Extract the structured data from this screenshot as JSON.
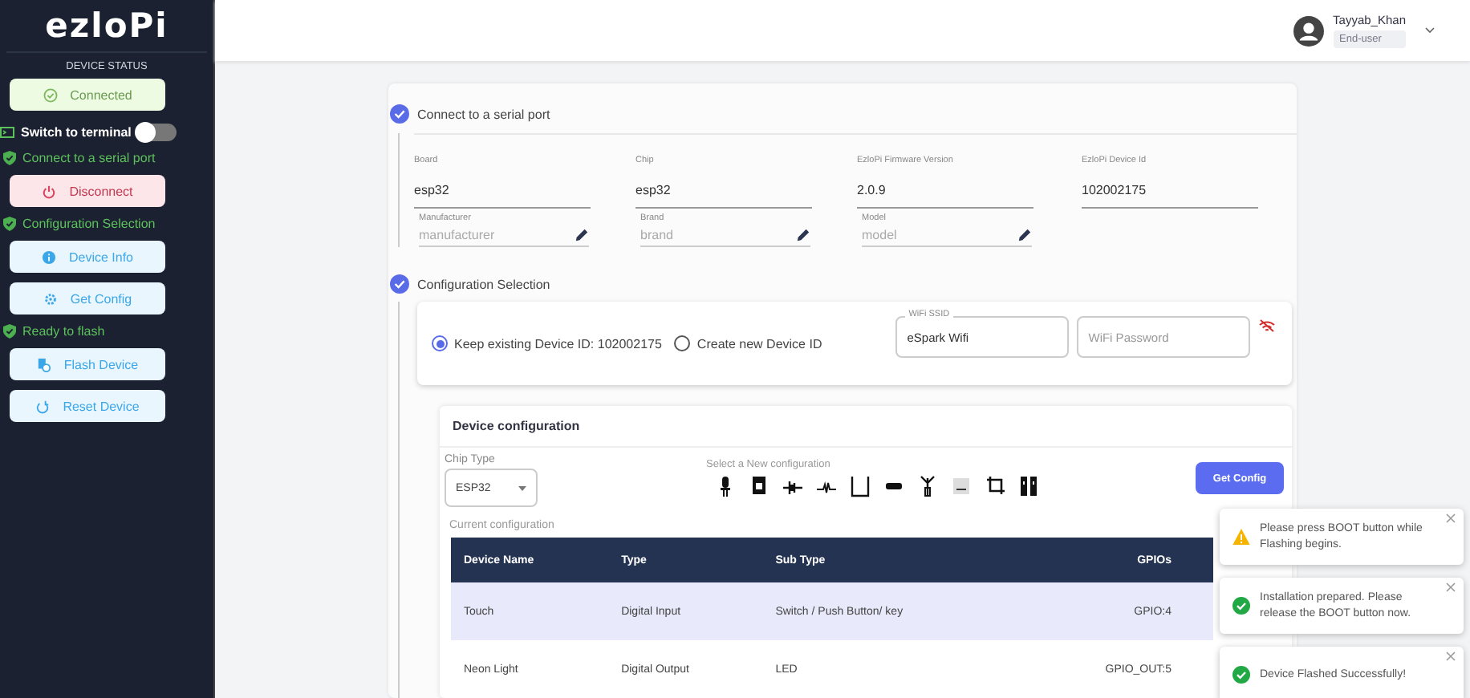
{
  "sidebar": {
    "logo": "ezloPi",
    "status_heading": "DEVICE STATUS",
    "status_button": {
      "label": "Connected",
      "kind": "status"
    },
    "terminal_switch": {
      "label": "Switch to terminal",
      "on": false
    },
    "sections": [
      {
        "title": "Connect to a serial port",
        "done": true,
        "buttons": [
          {
            "label": "Disconnect",
            "kind": "power"
          }
        ]
      },
      {
        "title": "Configuration Selection",
        "done": true,
        "buttons": [
          {
            "label": "Device Info",
            "kind": "info"
          },
          {
            "label": "Get Config",
            "kind": "config"
          }
        ]
      },
      {
        "title": "Ready to flash",
        "done": true,
        "buttons": [
          {
            "label": "Flash Device",
            "kind": "flash"
          },
          {
            "label": "Reset Device",
            "kind": "reset"
          }
        ]
      }
    ]
  },
  "user": {
    "name": "Tayyab_Khan",
    "role": "End-user"
  },
  "steps": [
    {
      "title": "Connect to a serial port",
      "done": true
    },
    {
      "title": "Configuration Selection",
      "done": true
    }
  ],
  "device_fields": [
    {
      "label": "Board",
      "value": "esp32"
    },
    {
      "label": "Chip",
      "value": "esp32"
    },
    {
      "label": "EzloPi Firmware Version",
      "value": "2.0.9"
    },
    {
      "label": "EzloPi Device Id",
      "value": "102002175"
    }
  ],
  "editable_fields": [
    {
      "label": "Manufacturer",
      "placeholder": "manufacturer"
    },
    {
      "label": "Brand",
      "placeholder": "brand"
    },
    {
      "label": "Model",
      "placeholder": "model"
    }
  ],
  "device_id_options": [
    {
      "label": "Keep existing Device ID: 102002175",
      "selected": true
    },
    {
      "label": "Create new Device ID",
      "selected": false
    }
  ],
  "wifi": {
    "ssid_label": "WiFi SSID",
    "ssid_value": "eSpark Wifi",
    "password_placeholder": "WiFi Password"
  },
  "device_configuration": {
    "title": "Device configuration",
    "chip_type": {
      "label": "Chip Type",
      "value": "ESP32"
    },
    "new_config_label": "Select a New configuration",
    "get_config_button": "Get Config",
    "current_label": "Current configuration",
    "columns": [
      "Device Name",
      "Type",
      "Sub Type",
      "GPIOs"
    ],
    "rows": [
      {
        "cells": [
          "Touch",
          "Digital Input",
          "Switch / Push Button/ key",
          "GPIO:4"
        ],
        "selected": true
      },
      {
        "cells": [
          "Neon Light",
          "Digital Output",
          "LED",
          "GPIO_OUT:5"
        ],
        "selected": false
      }
    ]
  },
  "toasts": [
    {
      "kind": "warning",
      "text": "Please press BOOT button while Flashing begins."
    },
    {
      "kind": "success",
      "text": "Installation prepared. Please release the BOOT button now."
    },
    {
      "kind": "success",
      "text": "Device Flashed Successfully!"
    }
  ]
}
